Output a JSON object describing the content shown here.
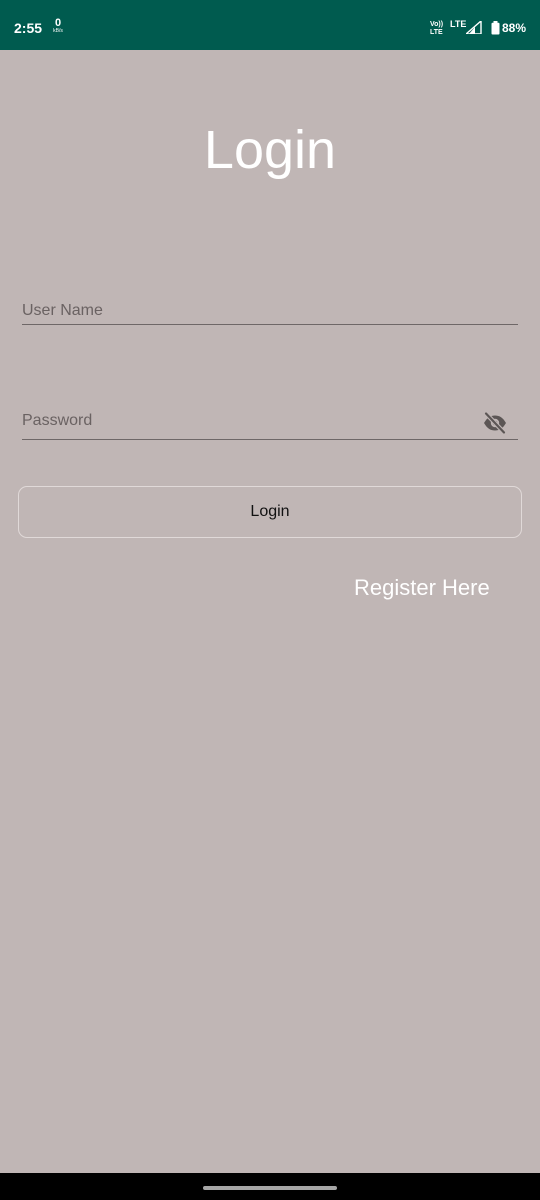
{
  "status_bar": {
    "time": "2:55",
    "net_speed_value": "0",
    "net_speed_unit": "kB/s",
    "volte_label": "Vo))\nLTE",
    "network_type": "LTE",
    "battery_percent": "88%",
    "battery_level": 0.88
  },
  "page": {
    "title": "Login"
  },
  "form": {
    "username_placeholder": "User Name",
    "username_value": "",
    "password_placeholder": "Password",
    "password_value": "",
    "password_toggle_icon": "eye-off-icon",
    "login_label": "Login",
    "register_label": "Register Here"
  },
  "colors": {
    "status_bar": "#005b4f",
    "background": "#c0b6b5",
    "text_light": "#ffffff",
    "underline": "#6e6767",
    "button_border": "#e0d9d8"
  }
}
